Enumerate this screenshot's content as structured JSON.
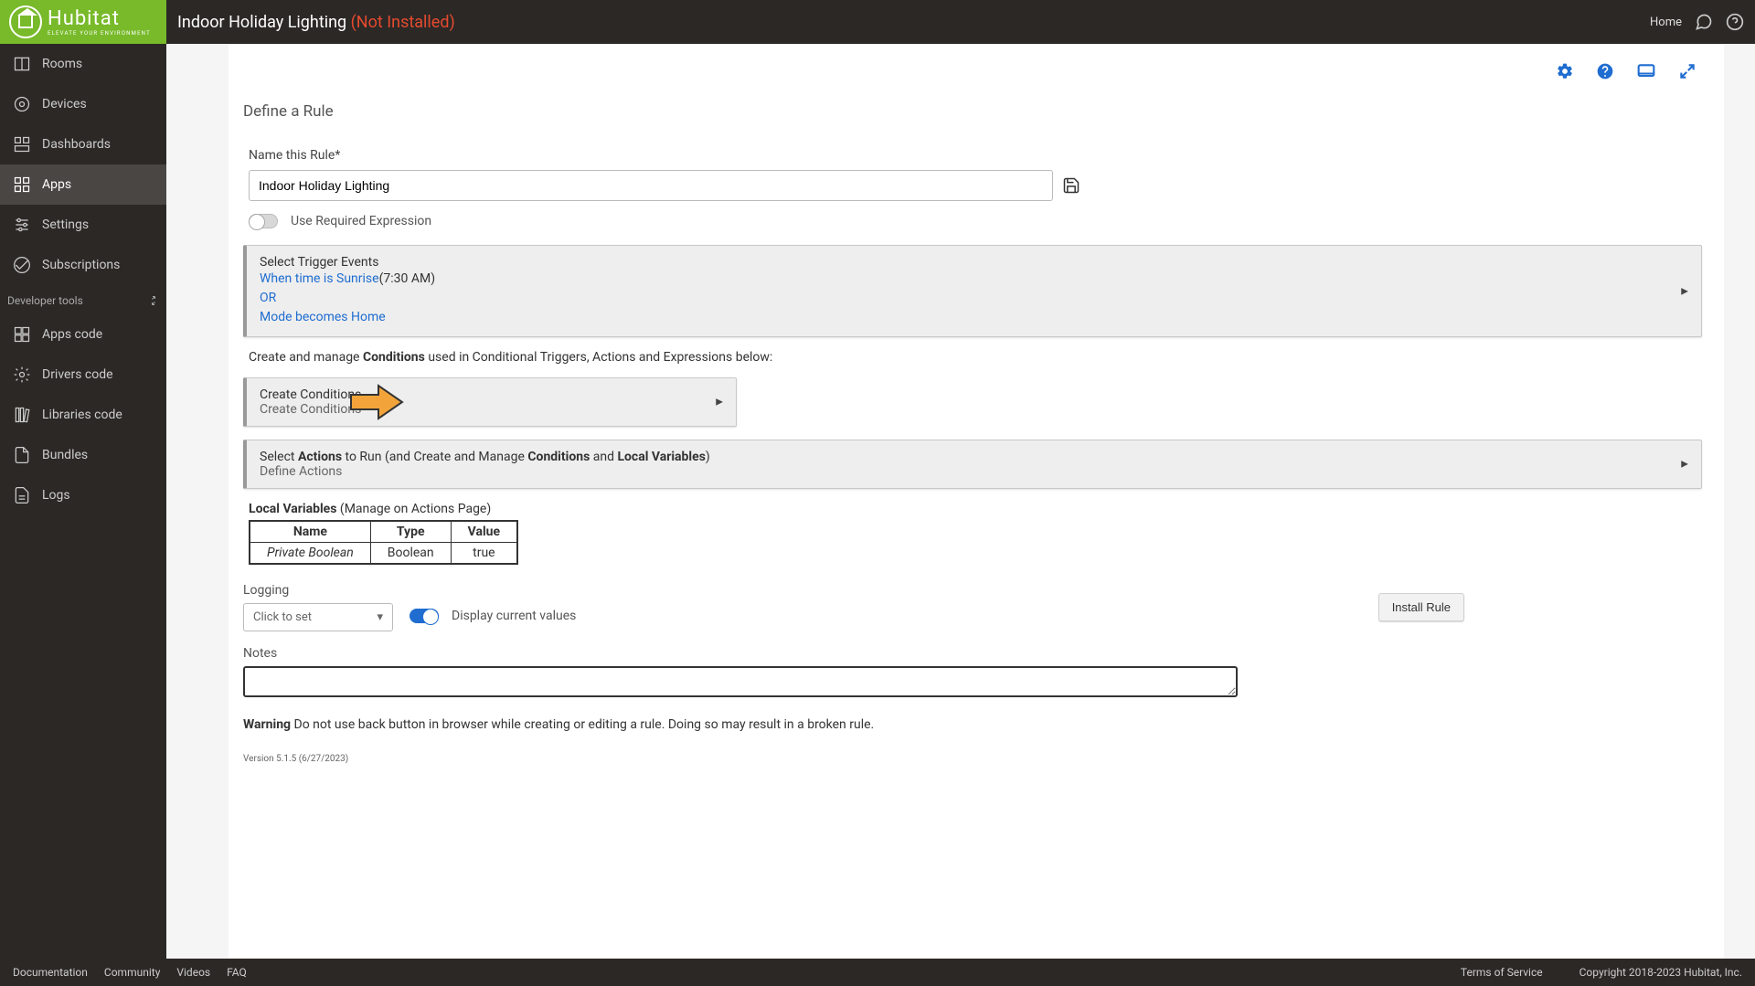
{
  "header": {
    "logo_name": "Hubitat",
    "logo_tag": "ELEVATE YOUR ENVIRONMENT",
    "page_title": "Indoor Holiday Lighting ",
    "page_status": "(Not Installed)",
    "home": "Home"
  },
  "sidebar": {
    "items": [
      {
        "label": "Rooms"
      },
      {
        "label": "Devices"
      },
      {
        "label": "Dashboards"
      },
      {
        "label": "Apps"
      },
      {
        "label": "Settings"
      },
      {
        "label": "Subscriptions"
      }
    ],
    "dev_tools": "Developer tools",
    "dev_items": [
      {
        "label": "Apps code"
      },
      {
        "label": "Drivers code"
      },
      {
        "label": "Libraries code"
      },
      {
        "label": "Bundles"
      },
      {
        "label": "Logs"
      }
    ]
  },
  "rule": {
    "section_title": "Define a Rule",
    "name_label": "Name this Rule*",
    "name_value": "Indoor Holiday Lighting",
    "required_expr": "Use Required Expression",
    "triggers": {
      "title": "Select Trigger Events",
      "line1_a": "When time is Sunrise",
      "line1_b": "(7:30 AM)",
      "line2": "OR",
      "line3": "Mode becomes Home"
    },
    "conditions_hint_a": "Create and manage ",
    "conditions_hint_b": "Conditions",
    "conditions_hint_c": " used in Conditional Triggers, Actions and Expressions below:",
    "create_cond_title": "Create Conditions",
    "create_cond_sub": "Create Conditions",
    "actions_a": "Select ",
    "actions_b": "Actions",
    "actions_c": " to Run (and Create and Manage ",
    "actions_d": "Conditions",
    "actions_e": " and ",
    "actions_f": "Local Variables",
    "actions_g": ")",
    "actions_sub": "Define Actions",
    "local_vars_a": "Local Variables",
    "local_vars_b": " (Manage on Actions Page)",
    "table": {
      "h1": "Name",
      "h2": "Type",
      "h3": "Value",
      "r1c1": "Private Boolean",
      "r1c2": "Boolean",
      "r1c3": "true"
    },
    "logging_label": "Logging",
    "logging_placeholder": "Click to set",
    "display_vals": "Display current values",
    "install": "Install Rule",
    "notes_label": "Notes",
    "warning_a": "Warning",
    "warning_b": " Do not use back button in browser while creating or editing a rule. Doing so may result in a broken rule.",
    "version": "Version 5.1.5 (6/27/2023)"
  },
  "footer": {
    "links": [
      "Documentation",
      "Community",
      "Videos",
      "FAQ"
    ],
    "tos": "Terms of Service",
    "copyright": "Copyright 2018-2023 Hubitat, Inc."
  }
}
